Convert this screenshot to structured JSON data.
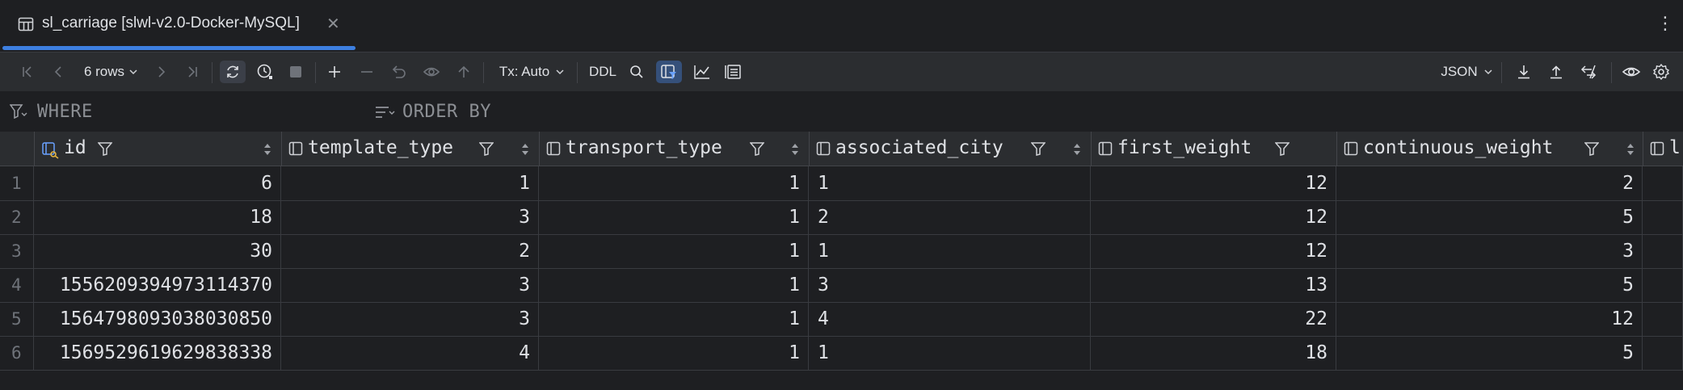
{
  "tab": {
    "title": "sl_carriage [slwl-v2.0-Docker-MySQL]",
    "close": "✕"
  },
  "toolbar": {
    "rows_label": "6 rows",
    "tx_label": "Tx: Auto",
    "ddl_label": "DDL",
    "format_label": "JSON"
  },
  "filters": {
    "where": "WHERE",
    "order_by": "ORDER BY"
  },
  "columns": [
    {
      "name": "id"
    },
    {
      "name": "template_type"
    },
    {
      "name": "transport_type"
    },
    {
      "name": "associated_city"
    },
    {
      "name": "first_weight"
    },
    {
      "name": "continuous_weight"
    },
    {
      "name": "l"
    }
  ],
  "rows": [
    {
      "n": "1",
      "id": "6",
      "template_type": "1",
      "transport_type": "1",
      "associated_city": "1",
      "first_weight": "12",
      "continuous_weight": "2"
    },
    {
      "n": "2",
      "id": "18",
      "template_type": "3",
      "transport_type": "1",
      "associated_city": "2",
      "first_weight": "12",
      "continuous_weight": "5"
    },
    {
      "n": "3",
      "id": "30",
      "template_type": "2",
      "transport_type": "1",
      "associated_city": "1",
      "first_weight": "12",
      "continuous_weight": "3"
    },
    {
      "n": "4",
      "id": "1556209394973114370",
      "template_type": "3",
      "transport_type": "1",
      "associated_city": "3",
      "first_weight": "13",
      "continuous_weight": "5"
    },
    {
      "n": "5",
      "id": "1564798093038030850",
      "template_type": "3",
      "transport_type": "1",
      "associated_city": "4",
      "first_weight": "22",
      "continuous_weight": "12"
    },
    {
      "n": "6",
      "id": "1569529619629838338",
      "template_type": "4",
      "transport_type": "1",
      "associated_city": "1",
      "first_weight": "18",
      "continuous_weight": "5"
    }
  ]
}
